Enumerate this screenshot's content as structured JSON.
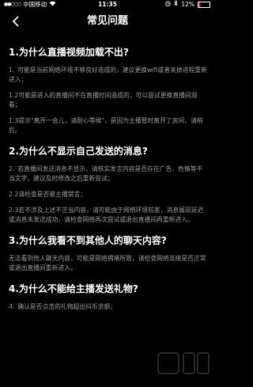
{
  "status_bar": {
    "carrier": "中国移动",
    "time": "11:35",
    "battery_percent": "12%"
  },
  "nav": {
    "title": "常见问题"
  },
  "sections": [
    {
      "question": "1.为什么直播视频加载不出?",
      "answers": [
        "1.`可能是当前网络环境不够良好造成的，建议更换wifi或者关掉进程重新进入；",
        "1.2可能是进入的直播间不在直播时间造成的，可以尝试更换直播间观看；",
        "1.3提示\"离开一会儿，请耐心等候\"，是因为主播暂时离开了房间，请稍后。"
      ]
    },
    {
      "question": "2.为什么不显示自己发送的消息?",
      "answers": [
        "2.`若直播间发送消息不显示，请核实发言内容是否存在广告、色情等不当文字，建议及时修改之后重新尝试；",
        "2.2请检查是否被主播禁言；",
        "2.3若不涉及上述不正当内容，请可能由于网络环境较差，消息展现延迟或消息未发送成功，请检查网络再次尝试或退出直播间再重新进入。"
      ]
    },
    {
      "question": "3.为什么我看不到其他人的聊天内容?",
      "answers": [
        "无法看到他人聊天内容，可能是网络拥堵所致，请检查网络连接是否正常或退出直播间重新进入。"
      ]
    },
    {
      "question": "4.为什么不能给主播发送礼物?",
      "answers": [
        "4.`确认是否点击的礼物超出抖币余额；"
      ]
    }
  ]
}
